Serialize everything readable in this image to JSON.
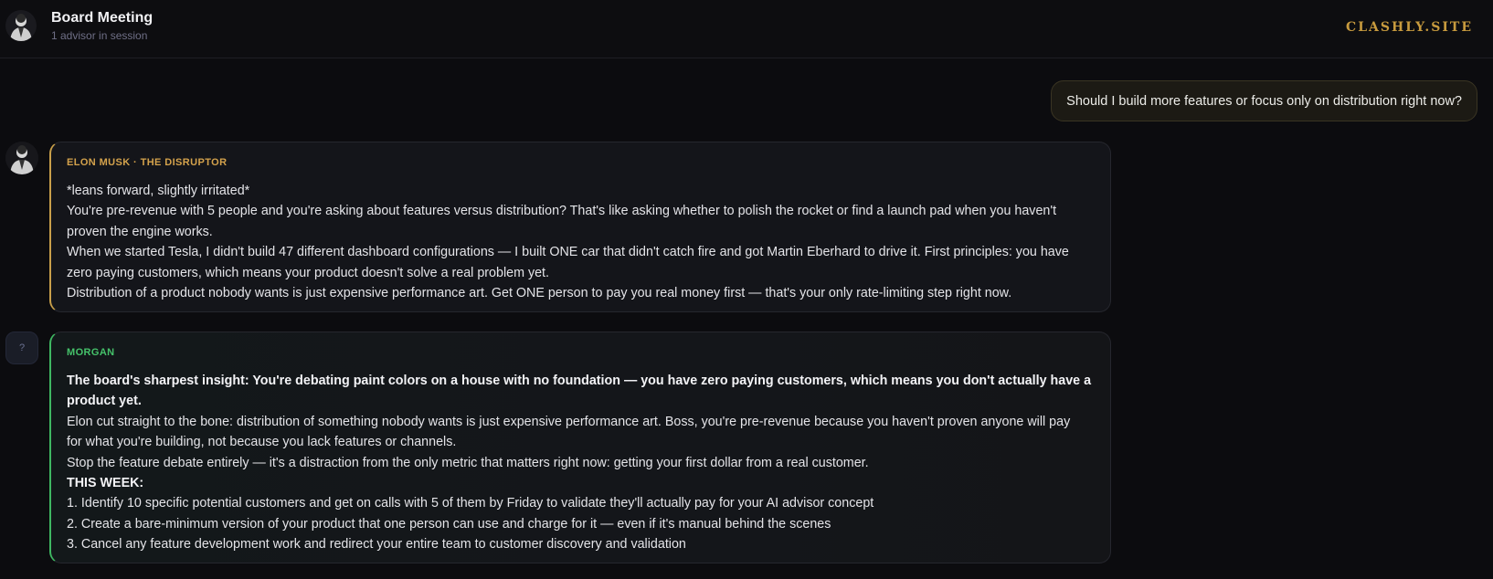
{
  "header": {
    "title": "Board Meeting",
    "subtitle": "1 advisor in session",
    "brand": "CLASHLY.SITE"
  },
  "user_message": "Should I build more features or focus only on distribution right now?",
  "advisor": {
    "speaker": "ELON MUSK · THE DISRUPTOR",
    "lines": [
      "*leans forward, slightly irritated*",
      "You're pre-revenue with 5 people and you're asking about features versus distribution? That's like asking whether to polish the rocket or find a launch pad when you haven't",
      "proven the engine works.",
      "When we started Tesla, I didn't build 47 different dashboard configurations — I built ONE car that didn't catch fire and got Martin Eberhard to drive it. First principles: you have",
      "zero paying customers, which means your product doesn't solve a real problem yet.",
      "Distribution of a product nobody wants is just expensive performance art. Get ONE person to pay you real money first — that's your only rate-limiting step right now."
    ]
  },
  "morgan": {
    "avatar_glyph": "?",
    "speaker": "MORGAN",
    "insight_1": "The board's sharpest insight: You're debating paint colors on a house with no foundation — you have zero paying customers, which means you don't actually have a",
    "insight_2": "product yet.",
    "lines": [
      "Elon cut straight to the bone: distribution of something nobody wants is just expensive performance art. Boss, you're pre-revenue because you haven't proven anyone will pay",
      "for what you're building, not because you lack features or channels.",
      "Stop the feature debate entirely — it's a distraction from the only metric that matters right now: getting your first dollar from a real customer."
    ],
    "week_label": "THIS WEEK:",
    "actions": [
      "1. Identify 10 specific potential customers and get on calls with 5 of them by Friday to validate they'll actually pay for your AI advisor concept",
      "2. Create a bare-minimum version of your product that one person can use and charge for it — even if it's manual behind the scenes",
      "3. Cancel any feature development work and redirect your entire team to customer discovery and validation"
    ]
  }
}
